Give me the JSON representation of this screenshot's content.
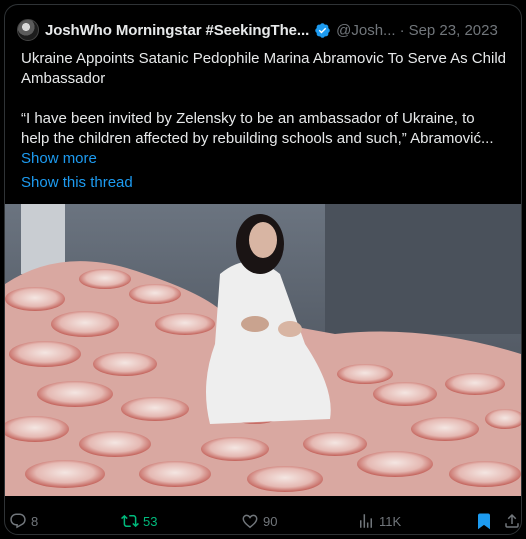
{
  "tweet": {
    "display_name": "JoshWho Morningstar #SeekingThe...",
    "handle": "@Josh...",
    "separator": "·",
    "date": "Sep 23, 2023",
    "headline": "Ukraine Appoints Satanic Pedophile Marina Abramovic To Serve As Child Ambassador",
    "quote": "“I have been invited by Zelensky to be an ambassador of Ukraine, to help the children affected by rebuilding schools and such,” Abramović...",
    "show_more": "Show more",
    "show_thread": "Show this thread"
  },
  "actions": {
    "replies": "8",
    "reposts": "53",
    "likes": "90",
    "views": "11K"
  },
  "colors": {
    "link": "#1d9bf0",
    "repost_active": "#00ba7c",
    "muted": "#71767b",
    "bookmark_active": "#1d9bf0"
  },
  "icons": [
    "verified-badge-icon",
    "reply-icon",
    "repost-icon",
    "like-icon",
    "views-icon",
    "bookmark-icon",
    "share-icon"
  ]
}
